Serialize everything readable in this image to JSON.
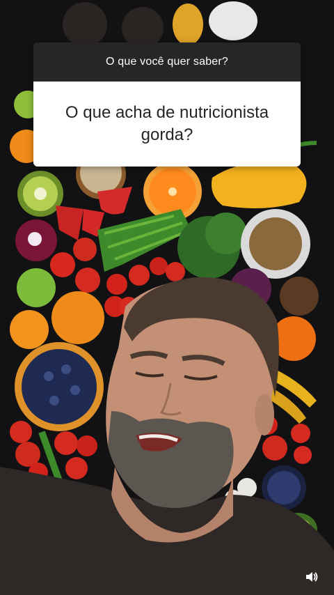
{
  "question_sticker": {
    "prompt": "O que você quer saber?",
    "question": "O que acha de nutricionista gorda?"
  },
  "controls": {
    "sound_icon": "speaker-icon"
  },
  "colors": {
    "sticker_header": "#262626",
    "sticker_body": "#ffffff",
    "sticker_text": "#262626"
  }
}
